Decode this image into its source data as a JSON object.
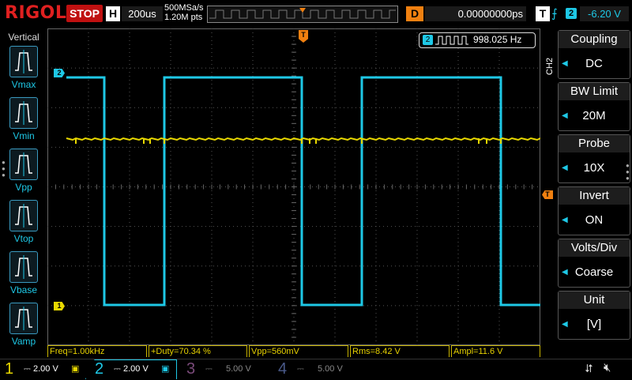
{
  "brand": "RIGOL",
  "run_state": "STOP",
  "horizontal": {
    "label": "H",
    "timebase": "200us",
    "sample_rate": "500MSa/s",
    "mem_depth": "1.20M pts"
  },
  "delay": {
    "label": "D",
    "value": "0.00000000ps"
  },
  "trigger": {
    "label": "T",
    "edge_icon": "rising-edge-icon",
    "source": "2",
    "level": "-6.20 V"
  },
  "left_panel": {
    "title": "Vertical",
    "items": [
      {
        "label": "Vmax",
        "icon": "vmax-waveform-icon"
      },
      {
        "label": "Vmin",
        "icon": "vmin-waveform-icon"
      },
      {
        "label": "Vpp",
        "icon": "vpp-waveform-icon"
      },
      {
        "label": "Vtop",
        "icon": "vtop-waveform-icon"
      },
      {
        "label": "Vbase",
        "icon": "vbase-waveform-icon"
      },
      {
        "label": "Vamp",
        "icon": "vamp-waveform-icon"
      }
    ]
  },
  "freq_counter": {
    "channel": "2",
    "value": "998.025 Hz"
  },
  "menu": {
    "channel_tag": "CH2",
    "items": [
      {
        "title": "Coupling",
        "value": "DC"
      },
      {
        "title": "BW Limit",
        "value": "20M"
      },
      {
        "title": "Probe",
        "value": "10X"
      },
      {
        "title": "Invert",
        "value": "ON"
      },
      {
        "title": "Volts/Div",
        "value": "Coarse"
      },
      {
        "title": "Unit",
        "value": "[V]"
      }
    ]
  },
  "measurements": [
    {
      "text": "Freq=1.00kHz"
    },
    {
      "text": "+Duty=70.34 %"
    },
    {
      "text": "Vpp=560mV"
    },
    {
      "text": "Rms=8.42 V"
    },
    {
      "text": "Ampl=11.6 V"
    }
  ],
  "channels": [
    {
      "num": "1",
      "scale": "2.00 V",
      "color": "#e8d800"
    },
    {
      "num": "2",
      "scale": "2.00 V",
      "color": "#1ec8e6"
    },
    {
      "num": "3",
      "scale": "5.00 V",
      "color": "#7a4a7a"
    },
    {
      "num": "4",
      "scale": "5.00 V",
      "color": "#4a5a8a"
    }
  ],
  "markers": {
    "ch1": "1",
    "ch2": "2",
    "trigger": "T"
  },
  "colors": {
    "ch1": "#e8d800",
    "ch2": "#1ec8e6",
    "trigger": "#f08010",
    "stop": "#c01010"
  }
}
